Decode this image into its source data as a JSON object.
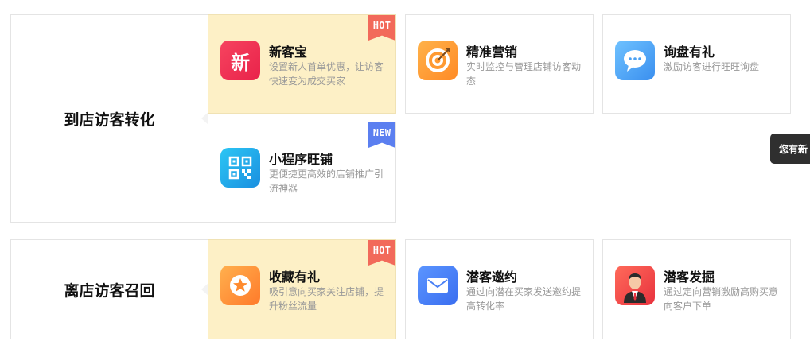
{
  "sections": [
    {
      "label": "到店访客转化",
      "cards": [
        {
          "title": "新客宝",
          "desc": "设置新人首单优惠，让访客快速变为成交买家",
          "badge": "HOT",
          "icon": "new-customer-icon",
          "icon_text": "新"
        },
        {
          "title": "精准营销",
          "desc": "实时监控与管理店铺访客动态",
          "icon": "target-icon"
        },
        {
          "title": "询盘有礼",
          "desc": "激励访客进行旺旺询盘",
          "icon": "chat-bubble-icon"
        },
        {
          "title": "小程序旺铺",
          "desc": "更便捷更高效的店铺推广引流神器",
          "badge": "NEW",
          "icon": "qr-code-icon"
        }
      ]
    },
    {
      "label": "离店访客召回",
      "cards": [
        {
          "title": "收藏有礼",
          "desc": "吸引意向买家关注店铺，提升粉丝流量",
          "badge": "HOT",
          "icon": "star-icon"
        },
        {
          "title": "潜客邀约",
          "desc": "通过向潜在买家发送邀约提高转化率",
          "icon": "envelope-icon"
        },
        {
          "title": "潜客发掘",
          "desc": "通过定向营销激励高购买意向客户下单",
          "icon": "person-icon"
        }
      ]
    }
  ],
  "toast": {
    "text": "您有新"
  },
  "colors": {
    "highlight_bg": "#fdf0c6",
    "hot_badge": "#f26a5a",
    "new_badge": "#5b7ff0"
  }
}
